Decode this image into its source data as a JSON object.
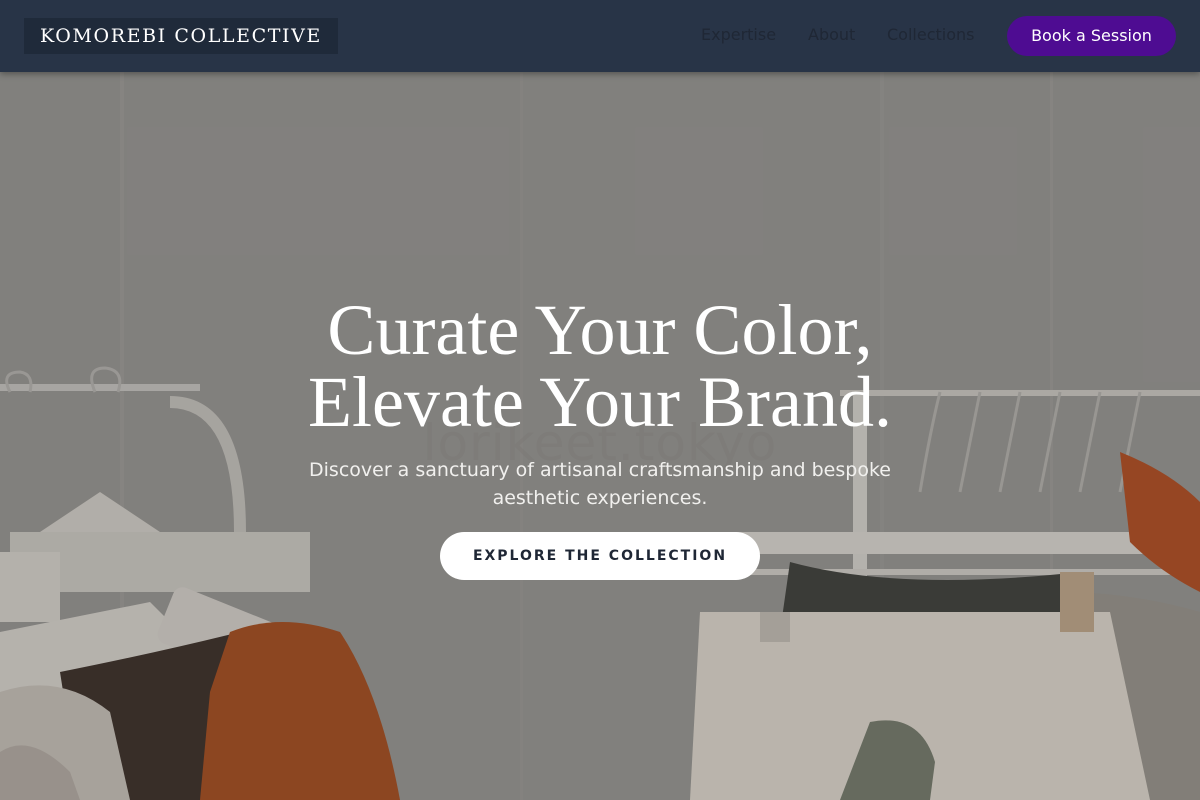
{
  "nav": {
    "brand": "KOMOREBI COLLECTIVE",
    "links": [
      {
        "label": "Expertise"
      },
      {
        "label": "About"
      },
      {
        "label": "Collections"
      }
    ],
    "cta_label": "Book a Session"
  },
  "hero": {
    "headline_line1": "Curate Your Color,",
    "headline_line2": "Elevate Your Brand.",
    "subheadline": "Discover a sanctuary of artisanal craftsmanship and bespoke aesthetic experiences.",
    "button_label": "EXPLORE THE COLLECTION",
    "watermark": "lorikeet.tokyo",
    "image_description_icon": "clothing-rack-photo"
  },
  "colors": {
    "nav_background": "#283447",
    "brand_background": "#1f2a3a",
    "accent": "#4e0c92",
    "hero_text": "#ffffff",
    "button_background": "#ffffff",
    "button_text": "#1f2735"
  }
}
